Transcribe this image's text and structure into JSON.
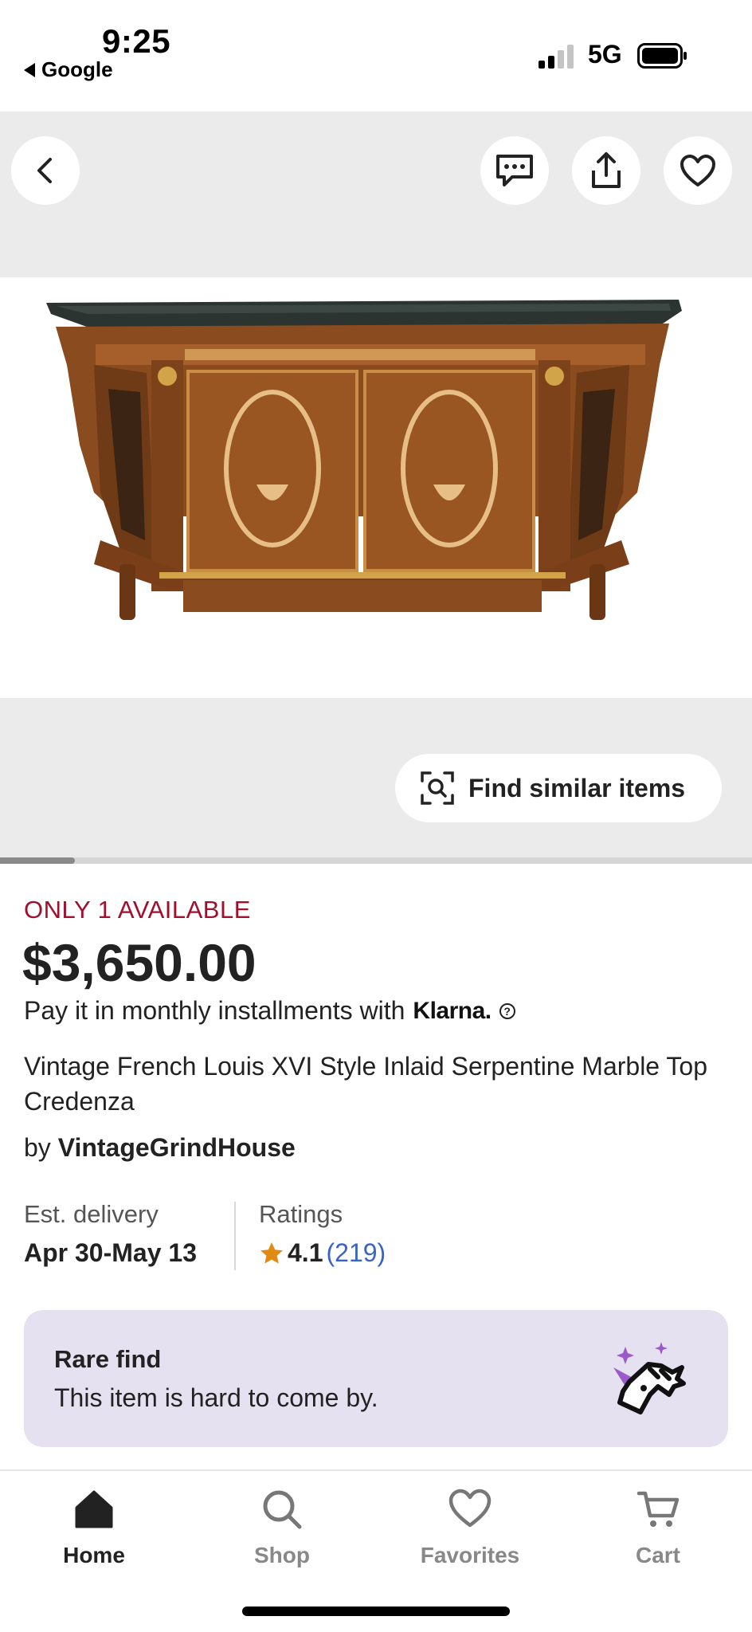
{
  "status_bar": {
    "time": "9:25",
    "back_app": "Google",
    "network": "5G"
  },
  "gallery": {
    "image_alt": "Vintage French Louis XVI style inlaid marble top credenza",
    "find_similar_label": "Find similar items",
    "buttons": {
      "back": "chevron-left-icon",
      "message": "message-icon",
      "share": "share-icon",
      "favorite": "heart-icon"
    },
    "image_position": 1
  },
  "listing": {
    "availability": "ONLY 1 AVAILABLE",
    "price": "$3,650.00",
    "installments_text": "Pay it in monthly installments with",
    "klarna_label": "Klarna.",
    "help_glyph": "?",
    "title": "Vintage French Louis XVI Style Inlaid Serpentine Marble Top Credenza",
    "seller_prefix": "by",
    "seller_name": "VintageGrindHouse",
    "delivery_label": "Est. delivery",
    "delivery_value": "Apr 30-May 13",
    "ratings_label": "Ratings",
    "rating_value": "4.1",
    "rating_count": "(219)"
  },
  "rare_find": {
    "title": "Rare find",
    "description": "This item is hard to come by."
  },
  "nav": {
    "items": [
      {
        "label": "Home",
        "icon": "home-icon",
        "active": true
      },
      {
        "label": "Shop",
        "icon": "search-icon",
        "active": false
      },
      {
        "label": "Favorites",
        "icon": "heart-icon",
        "active": false
      },
      {
        "label": "Cart",
        "icon": "cart-icon",
        "active": false
      }
    ]
  },
  "colors": {
    "availability": "#a10e2e",
    "rating_count": "#3a63c9",
    "star": "#e08a14",
    "rare_card_bg": "#e6e1f1",
    "gallery_bg": "#ebebeb"
  }
}
